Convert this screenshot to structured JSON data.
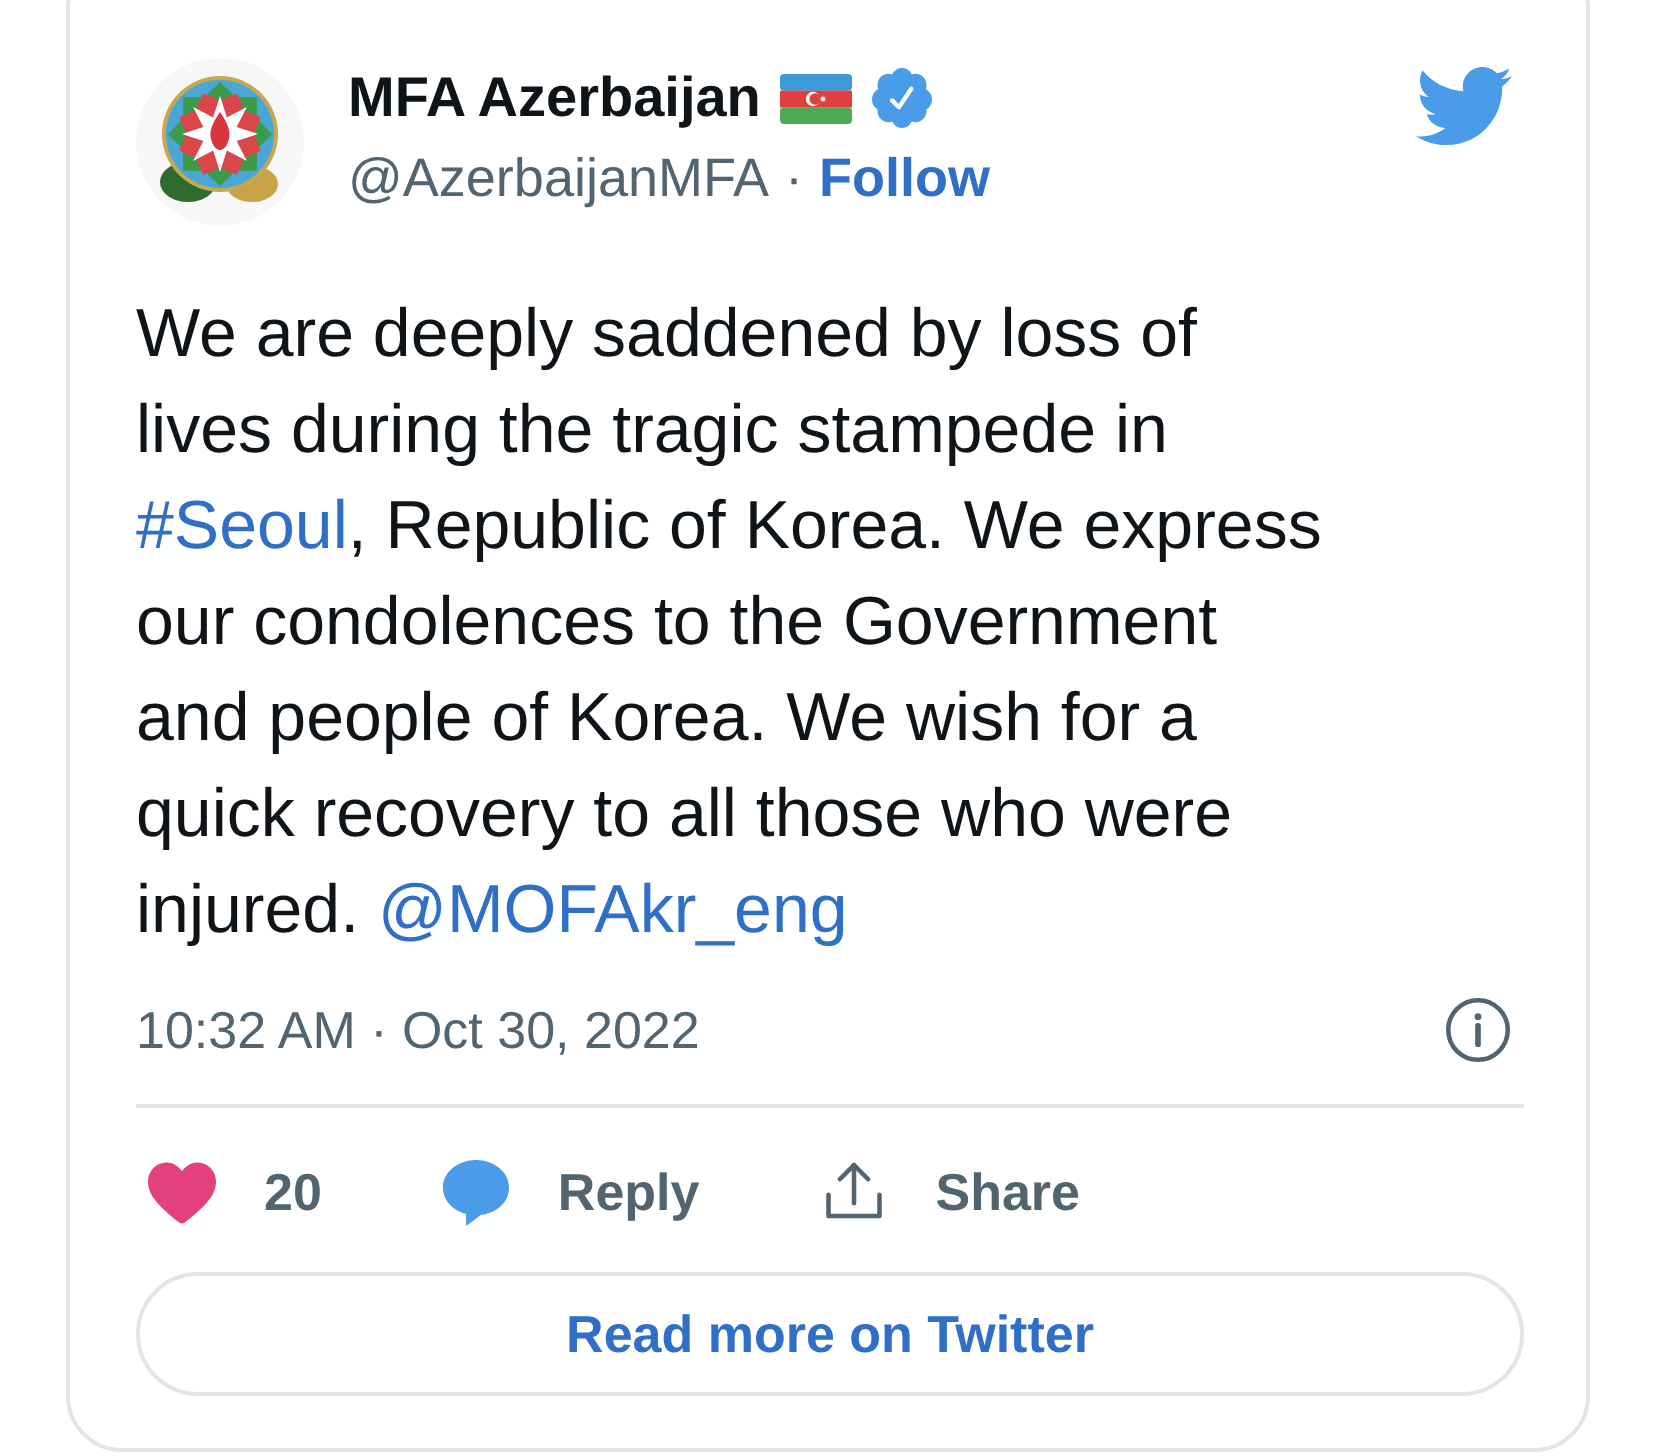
{
  "author": {
    "name": "MFA Azerbaijan",
    "verified": true,
    "handle": "@AzerbaijanMFA",
    "separator": "·",
    "follow": "Follow"
  },
  "tweet": {
    "segments": [
      {
        "kind": "text",
        "text": "We are deeply saddened by loss of lives during the tragic stampede in "
      },
      {
        "kind": "hashtag",
        "text": "#Seoul"
      },
      {
        "kind": "text",
        "text": ", Republic of Korea. We express our condolences to the Government and people of Korea. We wish for a quick recovery to all those who were injured. "
      },
      {
        "kind": "mention",
        "text": "@MOFAkr_eng"
      }
    ]
  },
  "timestamp": "10:32 AM · Oct 30, 2022",
  "actions": [
    {
      "kind": "like",
      "label": "20"
    },
    {
      "kind": "reply",
      "label": "Reply"
    },
    {
      "kind": "share",
      "label": "Share"
    }
  ],
  "read_more": "Read more on Twitter"
}
